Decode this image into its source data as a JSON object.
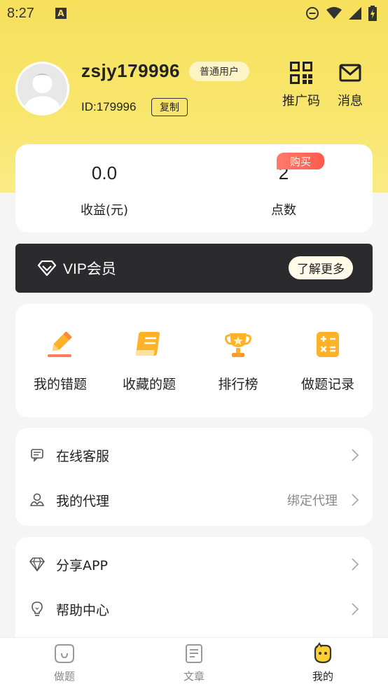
{
  "status_bar": {
    "time": "8:27"
  },
  "profile": {
    "username": "zsjy179996",
    "badge": "普通用户",
    "id_text": "ID:179996",
    "copy_label": "复制"
  },
  "header_actions": [
    {
      "label": "推广码",
      "icon": "qrcode-icon"
    },
    {
      "label": "消息",
      "icon": "mail-icon"
    }
  ],
  "stats": {
    "earnings": {
      "value": "0.0",
      "label": "收益(元)"
    },
    "points": {
      "value": "2",
      "label": "点数",
      "tag": "购买"
    }
  },
  "vip": {
    "label": "VIP会员",
    "more_label": "了解更多"
  },
  "quick_grid": [
    {
      "label": "我的错题",
      "icon": "pencil-icon"
    },
    {
      "label": "收藏的题",
      "icon": "book-icon"
    },
    {
      "label": "排行榜",
      "icon": "trophy-icon"
    },
    {
      "label": "做题记录",
      "icon": "calculator-icon"
    }
  ],
  "list_group_1": [
    {
      "label": "在线客服",
      "icon": "chat-icon",
      "extra": ""
    },
    {
      "label": "我的代理",
      "icon": "agent-icon",
      "extra": "绑定代理"
    }
  ],
  "list_group_2": [
    {
      "label": "分享APP",
      "icon": "diamond-icon",
      "extra": ""
    },
    {
      "label": "帮助中心",
      "icon": "bulb-icon",
      "extra": ""
    }
  ],
  "bottom_nav": [
    {
      "label": "做题",
      "icon": "practice-icon"
    },
    {
      "label": "文章",
      "icon": "article-icon"
    },
    {
      "label": "我的",
      "icon": "profile-icon"
    }
  ],
  "colors": {
    "header_bg": "#f6e05c",
    "vip_bg": "#2b2a2d",
    "buy_tag": "#ff5a4c",
    "accent_orange": "#ffb228"
  }
}
